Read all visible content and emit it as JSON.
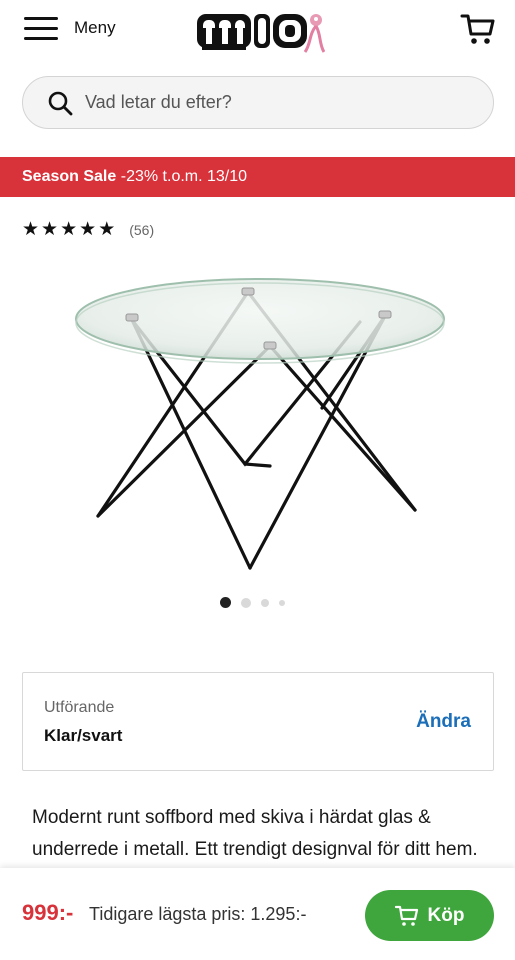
{
  "header": {
    "menu_label": "Meny",
    "logo_text": "mio",
    "logo_icon": "pink-ribbon-mascot",
    "cart_icon": "cart-icon"
  },
  "search": {
    "placeholder": "Vad letar du efter?"
  },
  "sale_banner": {
    "title": "Season Sale",
    "discount": "-23%",
    "period": "t.o.m. 13/10",
    "background_color": "#d8323a"
  },
  "rating": {
    "stars": 5,
    "review_count": "(56)"
  },
  "product_image": {
    "subject": "round glass coffee table with black metal hairpin legs"
  },
  "carousel": {
    "dot_count": 4,
    "active_index": 0
  },
  "variant": {
    "label": "Utförande",
    "value": "Klar/svart",
    "change_label": "Ändra"
  },
  "description": "Modernt runt soffbord med skiva i härdat glas & underrede i metall. Ett trendigt designval för ditt hem.",
  "bottom_bar": {
    "price": "999:-",
    "previous_price": "Tidigare lägsta pris: 1.295:-",
    "buy_label": "Köp",
    "price_color": "#d8323a",
    "buy_color": "#3ea63c"
  }
}
